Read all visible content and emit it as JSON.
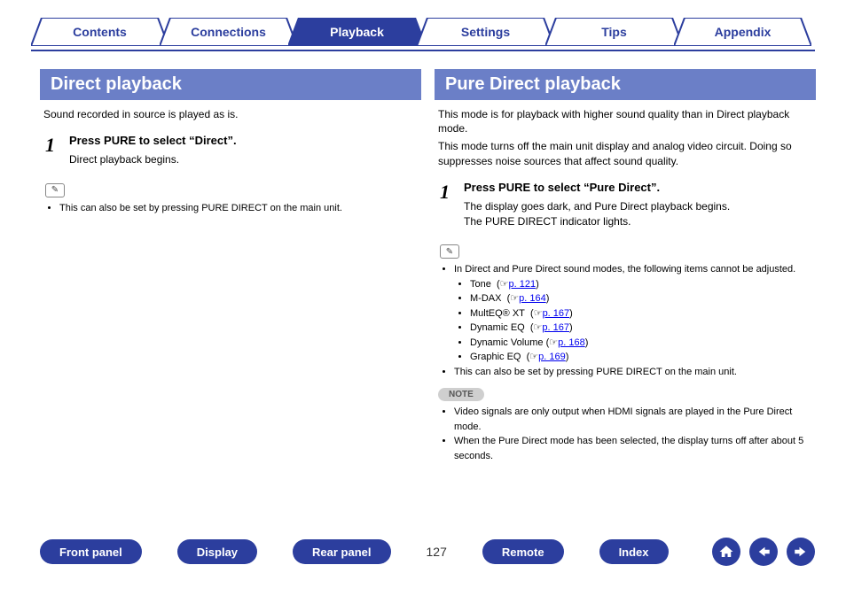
{
  "tabs": {
    "t0": "Contents",
    "t1": "Connections",
    "t2": "Playback",
    "t3": "Settings",
    "t4": "Tips",
    "t5": "Appendix",
    "active_index": 2
  },
  "left": {
    "title": "Direct playback",
    "intro": "Sound recorded in source is played as is.",
    "step_num": "1",
    "step_title": "Press PURE to select “Direct”.",
    "step_desc": "Direct playback begins.",
    "note0": "This can also be set by pressing PURE DIRECT on the main unit."
  },
  "right": {
    "title": "Pure Direct playback",
    "intro1": "This mode is for playback with higher sound quality than in Direct playback mode.",
    "intro2": "This mode turns off the main unit display and analog video circuit. Doing so suppresses noise sources that affect sound quality.",
    "step_num": "1",
    "step_title": "Press PURE to select “Pure Direct”.",
    "step_desc1": "The display goes dark, and Pure Direct playback begins.",
    "step_desc2": "The PURE DIRECT indicator lights.",
    "cannot_adjust_lead": "In Direct and Pure Direct sound modes, the following items cannot be adjusted.",
    "items": {
      "i0": {
        "name": "Tone",
        "page": "p. 121"
      },
      "i1": {
        "name": "M-DAX",
        "page": "p. 164"
      },
      "i2": {
        "name": "MultEQ® XT",
        "page": "p. 167"
      },
      "i3": {
        "name": "Dynamic EQ",
        "page": "p. 167"
      },
      "i4": {
        "name": "Dynamic Volume",
        "page": "p. 168"
      },
      "i5": {
        "name": "Graphic EQ",
        "page": "p. 169"
      }
    },
    "also_main_unit": "This can also be set by pressing PURE DIRECT on the main unit.",
    "note_label": "NOTE",
    "note1": "Video signals are only output when HDMI signals are played in the Pure Direct mode.",
    "note2": "When the Pure Direct mode has been selected, the display turns off after about 5 seconds."
  },
  "bottom": {
    "b0": "Front panel",
    "b1": "Display",
    "b2": "Rear panel",
    "page": "127",
    "b3": "Remote",
    "b4": "Index"
  },
  "glyph": {
    "pencil": "✎",
    "hand": "☞"
  }
}
